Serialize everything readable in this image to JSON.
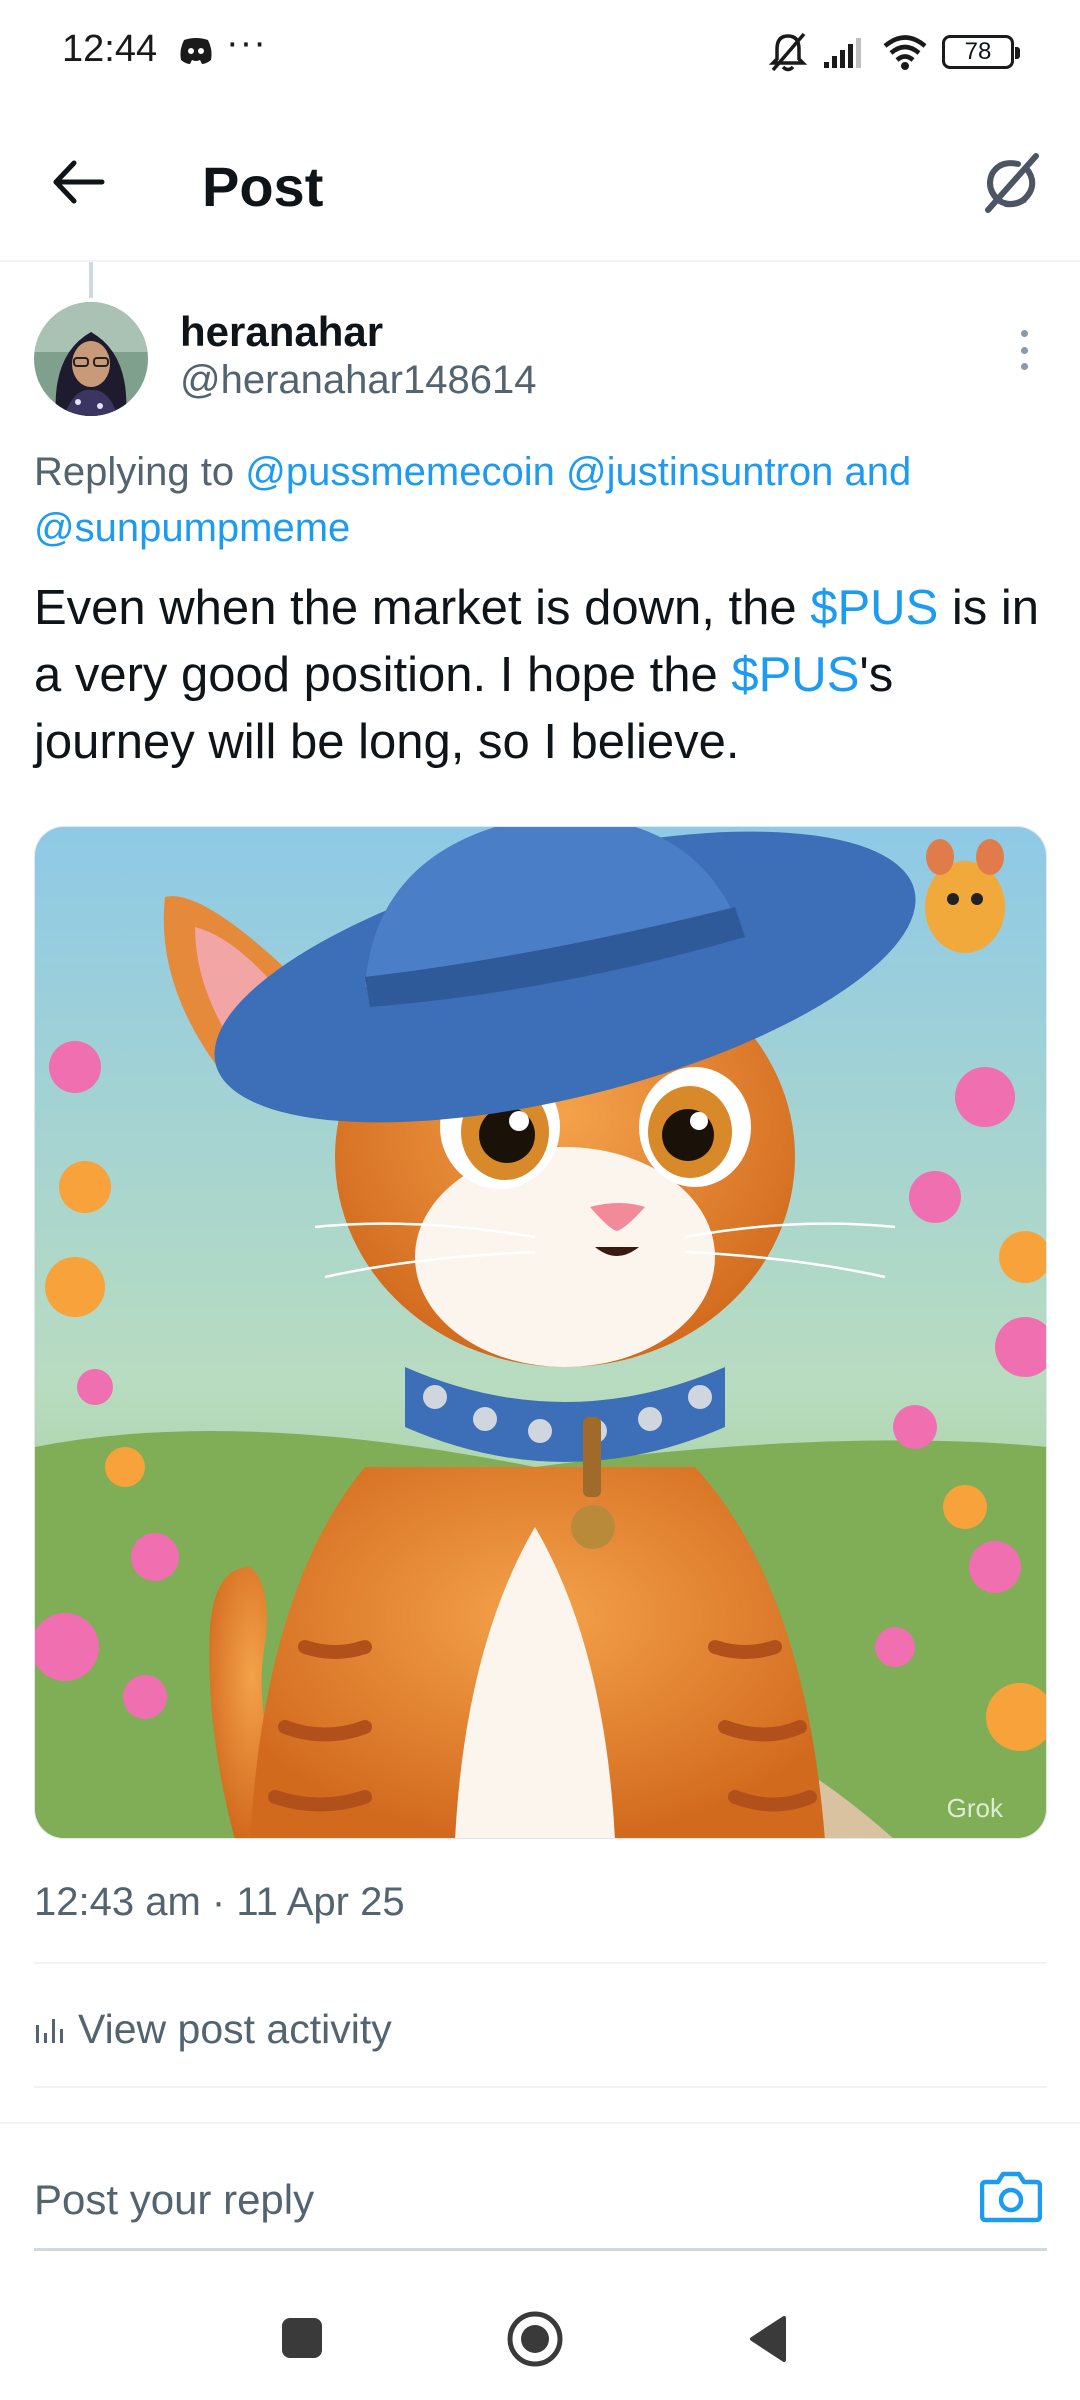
{
  "status_bar": {
    "time": "12:44",
    "dots": "···",
    "battery": "78"
  },
  "header": {
    "title": "Post",
    "back_icon": "arrow-left-icon",
    "grok_icon": "grok-icon"
  },
  "post": {
    "author_name": "heranahar",
    "author_handle": "@heranahar148614",
    "replying_prefix": "Replying to",
    "replying_to": [
      "@pussmemecoin",
      "@justinsuntron",
      "and",
      "@sunpumpmeme"
    ],
    "text_part1": "Even when the market is down, the ",
    "cashtag1": "$PUS",
    "text_part2": " is in a very good position. I hope the ",
    "cashtag2": "$PUS",
    "text_part3": "'s journey will be long, so I believe.",
    "image_watermark": "Grok",
    "timestamp": "12:43 am · 11 Apr 25",
    "activity_label": "View post activity"
  },
  "reply": {
    "placeholder": "Post your reply"
  },
  "colors": {
    "link": "#1d9bf0",
    "secondary_text": "#536471",
    "primary_text": "#0f1419"
  }
}
